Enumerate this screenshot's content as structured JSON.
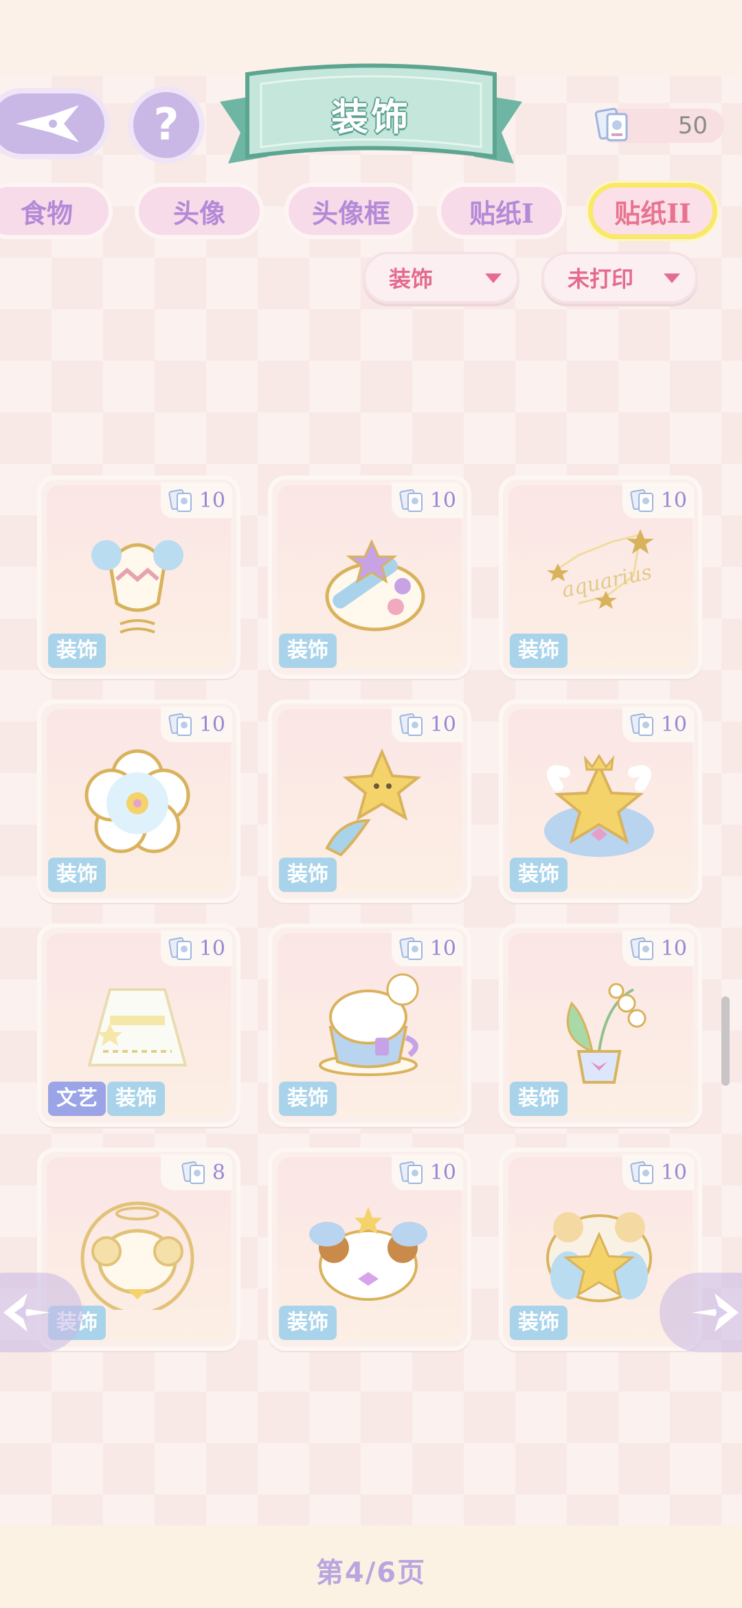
{
  "header": {
    "title": "装饰",
    "help_label": "?",
    "currency_value": "50"
  },
  "tabs": [
    {
      "label": "食物",
      "active": false
    },
    {
      "label": "头像",
      "active": false
    },
    {
      "label": "头像框",
      "active": false
    },
    {
      "label": "贴纸I",
      "active": false
    },
    {
      "label": "贴纸II",
      "active": true
    }
  ],
  "filters": {
    "type": "装饰",
    "print_status": "未打印"
  },
  "grid": {
    "items": [
      {
        "cost": "10",
        "tags": [
          "装饰"
        ],
        "art": "aquarius-urn-icon"
      },
      {
        "cost": "10",
        "tags": [
          "装饰"
        ],
        "art": "paint-palette-icon"
      },
      {
        "cost": "10",
        "tags": [
          "装饰"
        ],
        "art": "constellation-icon"
      },
      {
        "cost": "10",
        "tags": [
          "装饰"
        ],
        "art": "flower-icon"
      },
      {
        "cost": "10",
        "tags": [
          "装饰"
        ],
        "art": "star-wand-icon"
      },
      {
        "cost": "10",
        "tags": [
          "装饰"
        ],
        "art": "crowned-star-icon"
      },
      {
        "cost": "10",
        "tags": [
          "文艺",
          "装饰"
        ],
        "art": "white-dress-icon"
      },
      {
        "cost": "10",
        "tags": [
          "装饰"
        ],
        "art": "teacup-sheep-icon"
      },
      {
        "cost": "10",
        "tags": [
          "装饰"
        ],
        "art": "lily-of-valley-icon"
      },
      {
        "cost": "8",
        "tags": [
          "装饰"
        ],
        "art": "aries-sheep-icon"
      },
      {
        "cost": "10",
        "tags": [
          "装饰"
        ],
        "art": "ram-angel-icon"
      },
      {
        "cost": "10",
        "tags": [
          "装饰"
        ],
        "art": "sheep-hug-star-icon"
      }
    ],
    "constellation_text": "aquarius"
  },
  "tag_colors": {
    "装饰": "#a9d3ea",
    "文艺": "#9aa4e6"
  },
  "pagination": {
    "label": "第4/6页"
  }
}
